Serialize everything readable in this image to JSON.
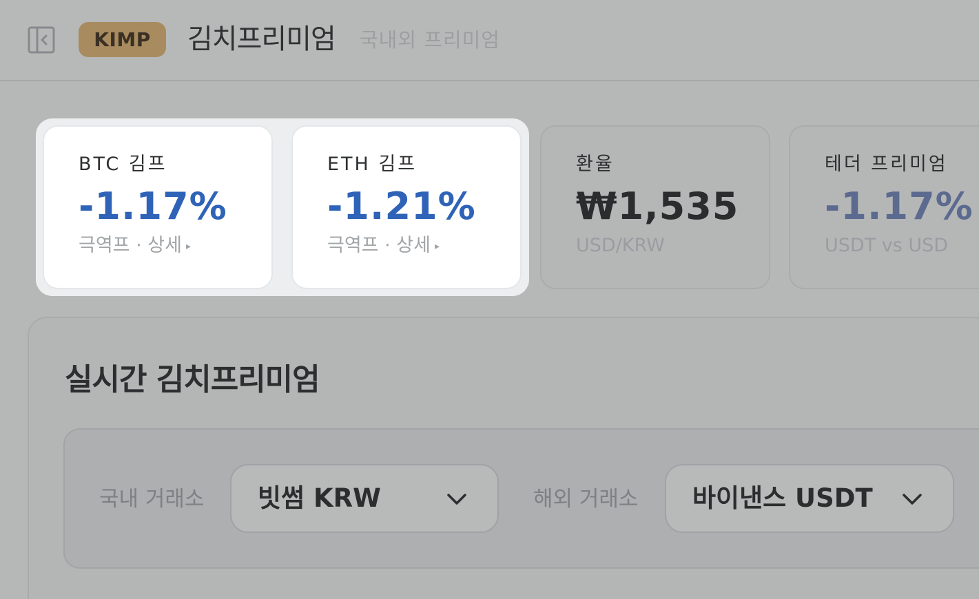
{
  "header": {
    "badge": "KIMP",
    "title": "김치프리미엄",
    "subtitle": "국내외 프리미엄"
  },
  "cards": [
    {
      "label": "BTC 김프",
      "value": "-1.17%",
      "sub": "극역프 · 상세",
      "arrow": "▸"
    },
    {
      "label": "ETH 김프",
      "value": "-1.21%",
      "sub": "극역프 · 상세",
      "arrow": "▸"
    },
    {
      "label": "환율",
      "value": "₩1,535",
      "sub": "USD/KRW"
    },
    {
      "label": "테더 프리미엄",
      "value": "-1.17%",
      "sub": "USDT vs USD"
    }
  ],
  "panel": {
    "title": "실시간 김치프리미엄",
    "domestic_label": "국내 거래소",
    "domestic_value": "빗썸 KRW",
    "overseas_label": "해외 거래소",
    "overseas_value": "바이낸스 USDT"
  },
  "colors": {
    "accent_blue": "#2f63b8",
    "badge_gold": "#a88b5f"
  },
  "icons": {
    "sidebar_toggle": "sidebar-collapse-icon",
    "dropdown": "chevron-down-icon"
  }
}
